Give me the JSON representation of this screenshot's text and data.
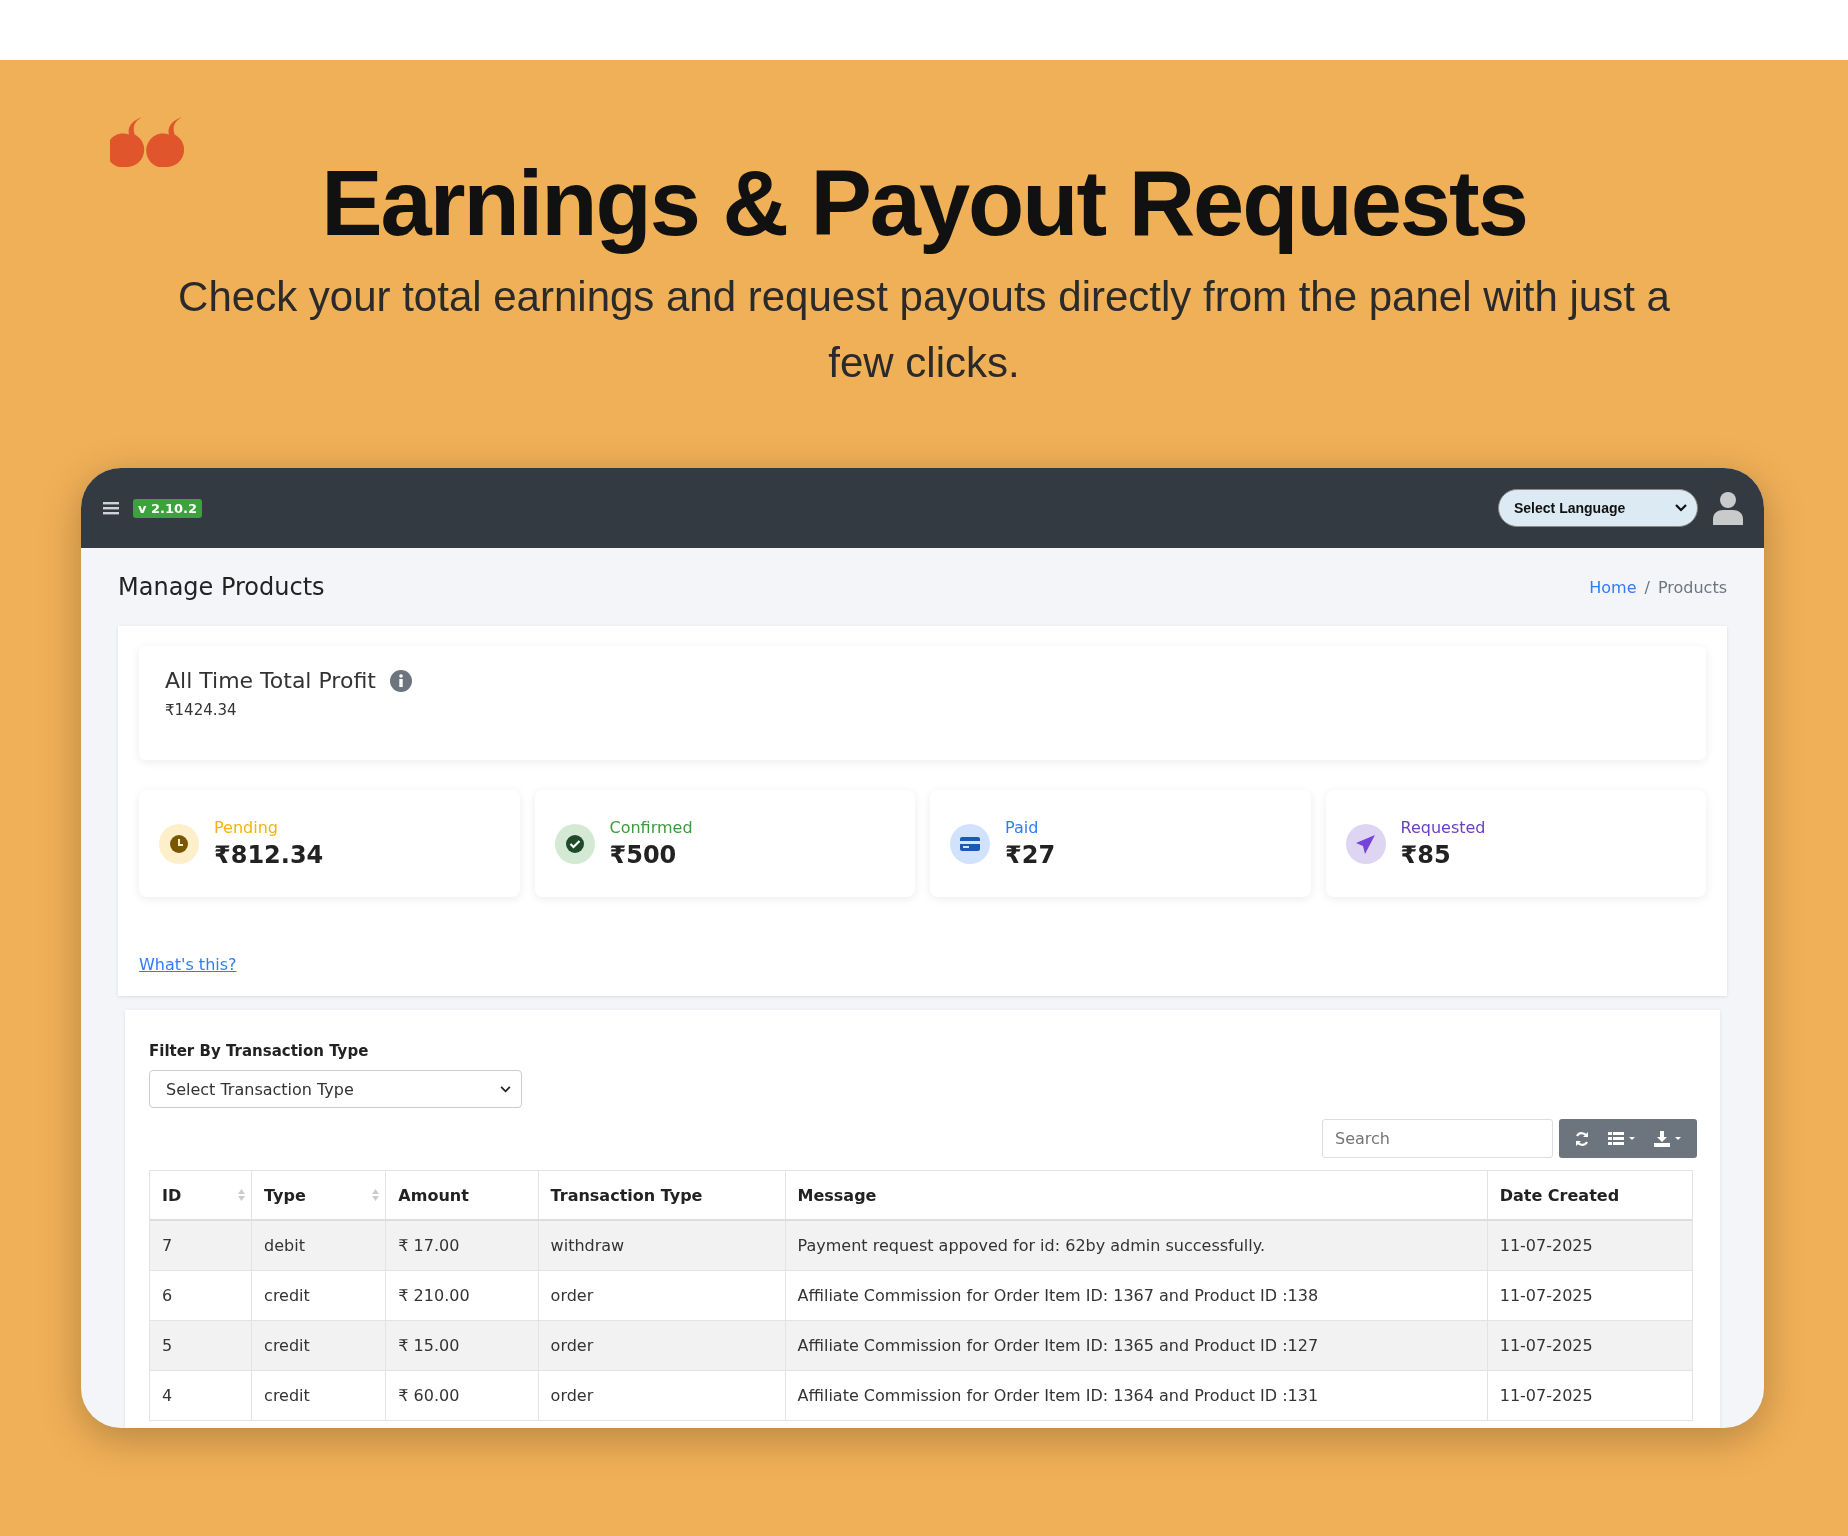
{
  "banner": {
    "title": "Earnings & Payout Requests",
    "subtitle": "Check your total earnings and request payouts directly from the panel with just a few clicks."
  },
  "window": {
    "version": "v 2.10.2",
    "language_select": "Select Language",
    "page_title": "Manage Products",
    "breadcrumb": [
      {
        "label": "Home",
        "link": true
      },
      {
        "label": "Products",
        "link": false
      }
    ],
    "breadcrumb_separator": "/",
    "profit": {
      "title": "All Time Total Profit",
      "value": "₹1424.34"
    },
    "stats": [
      {
        "kind": "clock",
        "label": "Pending",
        "value": "₹812.34",
        "color": "#f2b40c"
      },
      {
        "kind": "check",
        "label": "Confirmed",
        "value": "₹500",
        "color": "#3d9b3d"
      },
      {
        "kind": "card",
        "label": "Paid",
        "value": "₹27",
        "color": "#2f7cf6"
      },
      {
        "kind": "send",
        "label": "Requested",
        "value": "₹85",
        "color": "#6b3fc4"
      }
    ],
    "help_link": "What's this?",
    "filter": {
      "label": "Filter By Transaction Type",
      "placeholder": "Select Transaction Type"
    },
    "search": {
      "placeholder": "Search"
    },
    "table": {
      "columns": [
        {
          "label": "ID",
          "sortable": true
        },
        {
          "label": "Type",
          "sortable": true
        },
        {
          "label": "Amount",
          "sortable": false
        },
        {
          "label": "Transaction Type",
          "sortable": false
        },
        {
          "label": "Message",
          "sortable": false
        },
        {
          "label": "Date Created",
          "sortable": false
        }
      ],
      "rows": [
        [
          "7",
          "debit",
          "₹ 17.00",
          "withdraw",
          "Payment request appoved for id: 62by admin successfully.",
          "11-07-2025"
        ],
        [
          "6",
          "credit",
          "₹ 210.00",
          "order",
          "Affiliate Commission for Order Item ID: 1367 and Product ID :138",
          "11-07-2025"
        ],
        [
          "5",
          "credit",
          "₹ 15.00",
          "order",
          "Affiliate Commission for Order Item ID: 1365 and Product ID :127",
          "11-07-2025"
        ],
        [
          "4",
          "credit",
          "₹ 60.00",
          "order",
          "Affiliate Commission for Order Item ID: 1364 and Product ID :131",
          "11-07-2025"
        ]
      ]
    }
  }
}
